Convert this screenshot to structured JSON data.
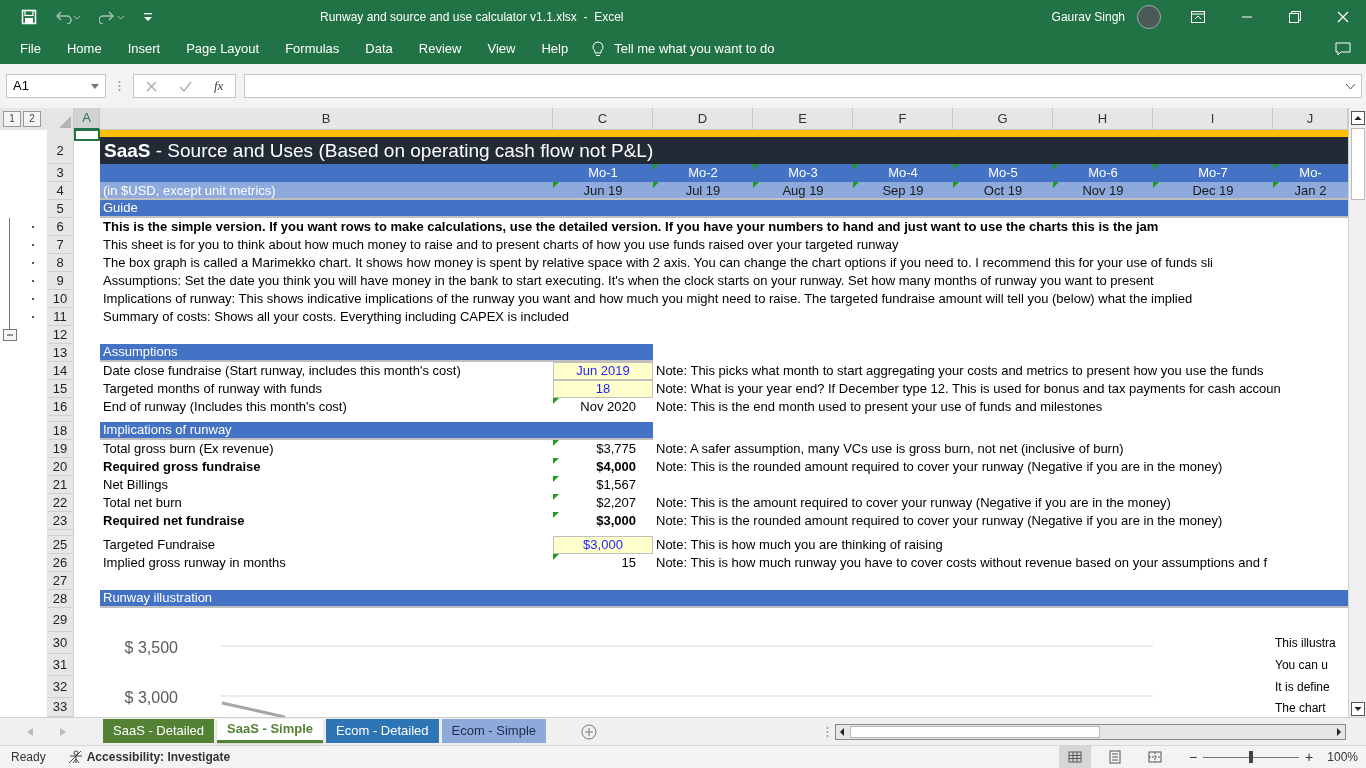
{
  "title_bar": {
    "title": "Runway and source and use calculator v1.1.xlsx  -  Excel",
    "user": "Gaurav Singh"
  },
  "ribbon_tabs": [
    "File",
    "Home",
    "Insert",
    "Page Layout",
    "Formulas",
    "Data",
    "Review",
    "View",
    "Help"
  ],
  "tell_me": "Tell me what you want to do",
  "formula_bar": {
    "name_box": "A1",
    "function_label": "fx"
  },
  "outline_levels": [
    "1",
    "2"
  ],
  "columns": [
    {
      "label": "A",
      "selected": true
    },
    {
      "label": "B",
      "selected": false
    },
    {
      "label": "C",
      "selected": false
    },
    {
      "label": "D",
      "selected": false
    },
    {
      "label": "E",
      "selected": false
    },
    {
      "label": "F",
      "selected": false
    },
    {
      "label": "G",
      "selected": false
    },
    {
      "label": "H",
      "selected": false
    },
    {
      "label": "I",
      "selected": false
    },
    {
      "label": "J",
      "selected": false
    }
  ],
  "rows": [
    {
      "kind": "top",
      "selected": true
    },
    {
      "number": "2",
      "kind": "title",
      "text": "**SaaS** - Source and Uses (Based on operating cash flow not P&L)"
    },
    {
      "number": "3",
      "kind": "months",
      "cells": [
        {
          "text": "Mo-1",
          "flag": false
        },
        {
          "text": "Mo-2",
          "flag": true
        },
        {
          "text": "Mo-3",
          "flag": true
        },
        {
          "text": "Mo-4",
          "flag": true
        },
        {
          "text": "Mo-5",
          "flag": true
        },
        {
          "text": "Mo-6",
          "flag": true
        },
        {
          "text": "Mo-7",
          "flag": true
        },
        {
          "text": "Mo-",
          "flag": true
        }
      ]
    },
    {
      "number": "4",
      "kind": "dates",
      "label": "(in $USD, except unit metrics)",
      "cells": [
        {
          "text": "Jun 19",
          "flag": true
        },
        {
          "text": "Jul 19",
          "flag": true
        },
        {
          "text": "Aug 19",
          "flag": true
        },
        {
          "text": "Sep 19",
          "flag": true
        },
        {
          "text": "Oct 19",
          "flag": true
        },
        {
          "text": "Nov 19",
          "flag": true
        },
        {
          "text": "Dec 19",
          "flag": true
        },
        {
          "text": "Jan 2",
          "flag": true
        }
      ]
    },
    {
      "number": "5",
      "kind": "section",
      "full_width": true,
      "label": "Guide"
    },
    {
      "number": "6",
      "kind": "text",
      "grouped": true,
      "bold": true,
      "text": "This is the simple version. If you want rows to make calculations, use the detailed version. If you have your numbers to hand and just want to use the charts this is the jam"
    },
    {
      "number": "7",
      "kind": "text",
      "grouped": true,
      "bold": false,
      "text": "This sheet is for you to think about how much money to raise and to present charts of how you use funds raised over your targeted runway"
    },
    {
      "number": "8",
      "kind": "text",
      "grouped": true,
      "bold": false,
      "text": "The box graph is called a Marimekko chart. It shows how money is spent by relative space with 2 axis. You can change the chart options if you need to. I recommend this for your use of funds sli"
    },
    {
      "number": "9",
      "kind": "text",
      "grouped": true,
      "bold": false,
      "text": "Assumptions: Set the date you think you will have money in the bank to start executing. It's when the clock starts on your runway. Set how many months of runway you want to present"
    },
    {
      "number": "10",
      "kind": "text",
      "grouped": true,
      "bold": false,
      "text": "Implications of runway: This shows indicative implications of the runway you want and how much you might need to raise. The targeted fundraise amount will tell you (below) what the implied"
    },
    {
      "number": "11",
      "kind": "text",
      "grouped": true,
      "bold": false,
      "text": "Summary of costs: Shows all your costs. Everything including CAPEX is included"
    },
    {
      "number": "12",
      "kind": "blank",
      "group_toggle": true
    },
    {
      "number": "13",
      "kind": "section",
      "full_width": false,
      "label": "Assumptions"
    },
    {
      "number": "14",
      "kind": "item",
      "label": "Date close fundraise (Start runway, includes this month's cost)",
      "value": "Jun 2019",
      "input": true,
      "flag": false,
      "bold": false,
      "note": "Note: This picks what month to start aggregating your costs and metrics to present how you use the funds"
    },
    {
      "number": "15",
      "kind": "item",
      "label": "Targeted months of runway with funds",
      "value": "18",
      "input": true,
      "flag": false,
      "bold": false,
      "note": "Note: What is your year end? If December type 12. This is used for bonus and tax payments for cash accoun"
    },
    {
      "number": "16",
      "kind": "item",
      "label": "End of runway (Includes this month's cost)",
      "value": "Nov 2020",
      "input": false,
      "flag": true,
      "bold": false,
      "note": "Note: This is the end month used to present your use of funds and milestones"
    },
    {
      "kind": "thin"
    },
    {
      "number": "18",
      "kind": "section",
      "full_width": false,
      "label": "Implications of runway"
    },
    {
      "number": "19",
      "kind": "item",
      "label": "Total gross burn (Ex revenue)",
      "value": "$3,775",
      "input": false,
      "flag": true,
      "bold": false,
      "note": "Note: A safer assumption, many VCs use is gross burn, not net (inclusive of burn)"
    },
    {
      "number": "20",
      "kind": "item",
      "label": "Required gross fundraise",
      "value": "$4,000",
      "input": false,
      "flag": true,
      "bold": true,
      "note": "Note: This is the rounded amount required to cover your runway (Negative if you are in the money)"
    },
    {
      "number": "21",
      "kind": "item",
      "label": "Net Billings",
      "value": "$1,567",
      "input": false,
      "flag": true,
      "bold": false
    },
    {
      "number": "22",
      "kind": "item",
      "label": "Total net burn",
      "value": "$2,207",
      "input": false,
      "flag": true,
      "bold": false,
      "note": "Note: This is the amount required to cover your runway (Negative if you are in the money)"
    },
    {
      "number": "23",
      "kind": "item",
      "label": "Required net fundraise",
      "value": "$3,000",
      "input": false,
      "flag": true,
      "bold": true,
      "note": "Note: This is the rounded amount required to cover your runway (Negative if you are in the money)"
    },
    {
      "kind": "thin"
    },
    {
      "number": "25",
      "kind": "item",
      "label": "Targeted Fundraise",
      "value": "$3,000",
      "input": true,
      "flag": false,
      "bold": false,
      "note": "Note: This is how much you are thinking of raising"
    },
    {
      "number": "26",
      "kind": "item",
      "label": "Implied gross runway in months",
      "value": "15",
      "input": false,
      "flag": true,
      "bold": false,
      "note": "Note: This is how much runway you have to cover costs without revenue based on your assumptions and f"
    },
    {
      "number": "27",
      "kind": "blank"
    },
    {
      "number": "28",
      "kind": "section",
      "full_width": true,
      "label": "Runway illustration"
    },
    {
      "kind": "chart",
      "numbers": [
        "29",
        "30",
        "31",
        "32",
        "33"
      ],
      "y_labels": [
        "$ 3,500",
        "$ 3,000"
      ],
      "side_text": [
        "This illustra",
        "You can u",
        "It is define",
        "The chart"
      ]
    }
  ],
  "sheet_tabs": [
    {
      "label": "SaaS - Detailed",
      "color": "#548235",
      "selected": false
    },
    {
      "label": "SaaS - Simple",
      "color": "#548235",
      "selected": true
    },
    {
      "label": "Ecom - Detailed",
      "color": "#2e75b6",
      "selected": false
    },
    {
      "label": "Ecom - Simple",
      "color": "#8eaadb",
      "selected": false
    }
  ],
  "status_bar": {
    "mode": "Ready",
    "accessibility": "Accessibility: Investigate",
    "views": [
      {
        "kind": "normal",
        "selected": true
      },
      {
        "kind": "page_layout",
        "selected": false
      },
      {
        "kind": "page_break",
        "selected": false
      }
    ],
    "zoom_out": "−",
    "zoom_in": "+",
    "zoom": {
      "level": 0.5
    },
    "zoom_label": "100%"
  }
}
